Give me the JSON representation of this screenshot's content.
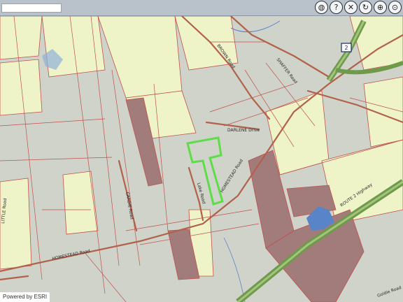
{
  "toolbar": {
    "search_value": "",
    "tools": [
      {
        "icon": "globe-icon",
        "glyph": "◍"
      },
      {
        "icon": "help-icon",
        "glyph": "?"
      },
      {
        "icon": "clear-icon",
        "glyph": "✕"
      },
      {
        "icon": "pan-icon",
        "glyph": "↻"
      },
      {
        "icon": "zoom-icon",
        "glyph": "⊕"
      },
      {
        "icon": "full-extent-icon",
        "glyph": "⊙"
      }
    ]
  },
  "map": {
    "road_labels": [
      "HOMESTEAD Road",
      "HOMESTEAD Road",
      "DARLENE Drive",
      "ROUTE 2 Highway",
      "BROWN Road",
      "SHAFFER Road",
      "Goldie Road",
      "LITTLE Road",
      "CARDIE Road",
      "Lake Road"
    ],
    "route_shield": "2",
    "colors": {
      "parcel_fill": "#eef4c8",
      "wooded_fill": "#c9cec4",
      "restricted_fill": "#a17c7a",
      "parcel_line": "#c0514d",
      "highway": "#6f9a4a",
      "road": "#b2614a",
      "water": "#5a84c8",
      "highlight": "#5fdc4a"
    },
    "attribution": "Powered by ESRI"
  }
}
